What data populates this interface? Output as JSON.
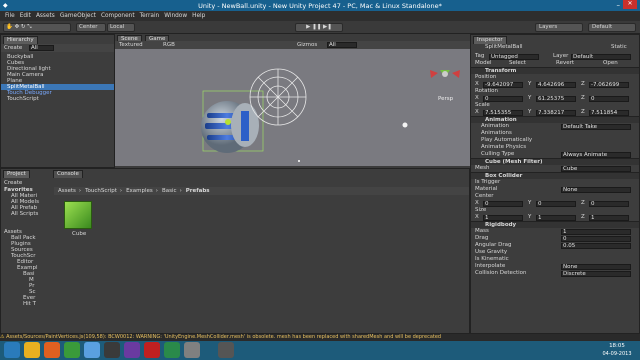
{
  "window": {
    "title": "Unity - NewBall.unity - New Unity Project 47 - PC, Mac & Linux Standalone*"
  },
  "menu": [
    "File",
    "Edit",
    "Assets",
    "GameObject",
    "Component",
    "Terrain",
    "Window",
    "Help"
  ],
  "toolbar": {
    "center": "Center",
    "local": "Local",
    "layers": "Layers",
    "layout": "Default"
  },
  "hierarchy": {
    "tab": "Hierarchy",
    "create": "Create",
    "search": "All",
    "items": [
      "Buckyball",
      "Cubes",
      "Directional light",
      "Main Camera",
      "Plane",
      "SplitMetalBall",
      "Touch Debugger",
      "TouchScript"
    ]
  },
  "scene": {
    "tab_scene": "Scene",
    "tab_game": "Game",
    "shading": "Textured",
    "rgb": "RGB",
    "gizmos": "Gizmos",
    "search": "All",
    "persp": "Persp"
  },
  "project": {
    "tab": "Project",
    "console": "Console",
    "create": "Create",
    "favorites": [
      "Favorites",
      "All Materi",
      "All Models",
      "All Prefab",
      "All Scripts"
    ],
    "assets": [
      "Assets",
      "Ball Pack",
      "Plugins",
      "Sources",
      "TouchScr",
      "Editor",
      "Exampl",
      "Basi",
      "M",
      "Pr",
      "Sc",
      "Ever",
      "Hit T"
    ],
    "breadcrumb": [
      "Assets",
      "TouchScript",
      "Examples",
      "Basic",
      "Prefabs"
    ],
    "asset_item": "Cube"
  },
  "inspector": {
    "tab": "Inspector",
    "static": "Static",
    "name": "SplitMetalBall",
    "tag_label": "Tag",
    "tag": "Untagged",
    "layer_label": "Layer",
    "layer": "Default",
    "model": "Model",
    "select": "Select",
    "revert": "Revert",
    "open": "Open",
    "transform": "Transform",
    "position": "Position",
    "pos": {
      "x": "-9.642097",
      "y": "4.642696",
      "z": "-7.062699"
    },
    "rotation": "Rotation",
    "rot": {
      "x": "0",
      "y": "61.25375",
      "z": "0"
    },
    "scale": "Scale",
    "scl": {
      "x": "7.515355",
      "y": "7.338217",
      "z": "7.511854"
    },
    "animation": "Animation",
    "anim_rows": [
      [
        "Animation",
        "Default Take"
      ],
      [
        "Animations",
        ""
      ],
      [
        "Play Automatically",
        ""
      ],
      [
        "Animate Physics",
        ""
      ],
      [
        "Culling Type",
        "Always Animate"
      ]
    ],
    "mesh_filter": "Cube (Mesh Filter)",
    "mesh_label": "Mesh",
    "mesh": "Cube",
    "box_collider": "Box Collider",
    "bc_rows": [
      [
        "Is Trigger",
        ""
      ],
      [
        "Material",
        "None"
      ]
    ],
    "center": "Center",
    "center_v": {
      "x": "0",
      "y": "0",
      "z": "0"
    },
    "size": "Size",
    "size_v": {
      "x": "1",
      "y": "1",
      "z": "1"
    },
    "rigidbody": "Rigidbody",
    "rb_rows": [
      [
        "Mass",
        "1"
      ],
      [
        "Drag",
        "0"
      ],
      [
        "Angular Drag",
        "0.05"
      ],
      [
        "Use Gravity",
        ""
      ],
      [
        "Is Kinematic",
        ""
      ],
      [
        "Interpolate",
        "None"
      ],
      [
        "Collision Detection",
        "Discrete"
      ]
    ]
  },
  "status": "Assets/Sources/PaintVertices.js(109,58): BCW0012: WARNING: 'UnityEngine.MeshCollider.mesh' is obsolete. mesh has been replaced with sharedMesh and will be deprecated",
  "clock": {
    "time": "18:05",
    "date": "04-09-2013"
  },
  "colors": {
    "title": "#17608e",
    "taskbar": "#1d5b7a",
    "highlight": "#3b77b7"
  }
}
